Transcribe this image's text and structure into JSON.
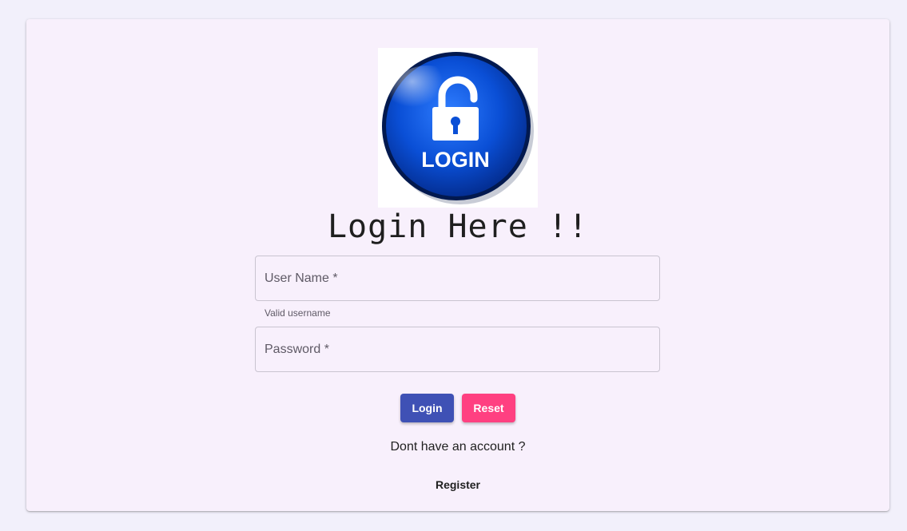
{
  "logo": {
    "text": "LOGIN",
    "icon": "padlock-open-icon"
  },
  "title": "Login Here !!",
  "form": {
    "username": {
      "placeholder": "User Name *",
      "value": "",
      "hint": "Valid username"
    },
    "password": {
      "placeholder": "Password *",
      "value": ""
    }
  },
  "buttons": {
    "login_label": "Login",
    "reset_label": "Reset"
  },
  "footer": {
    "prompt": "Dont have an account ?",
    "register_label": "Register"
  },
  "colors": {
    "background": "#f2f0fb",
    "card": "#f8f0fc",
    "primary": "#3f51b5",
    "accent": "#ff4081",
    "logo_blue": "#0a4fd6"
  }
}
